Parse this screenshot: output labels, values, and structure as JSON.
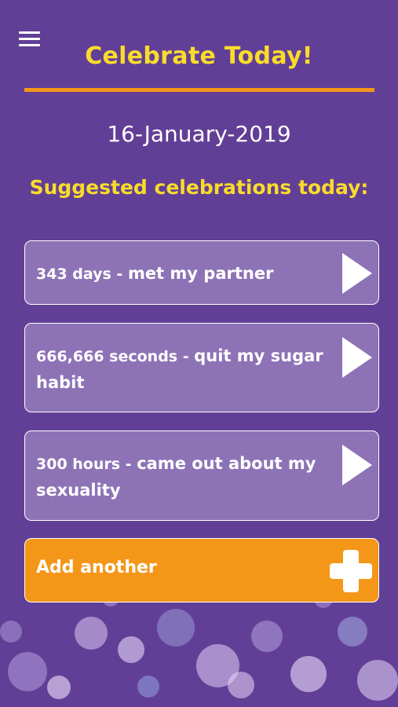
{
  "header": {
    "menu_icon": "hamburger-menu-icon",
    "title": "Celebrate Today!"
  },
  "date": "16-January-2019",
  "subtitle": "Suggested celebrations today:",
  "suggestions": [
    {
      "duration": "343 days - ",
      "description": "met my partner",
      "icon": "play-arrow-icon"
    },
    {
      "duration": "666,666 seconds - ",
      "description": "quit my sugar habit",
      "icon": "play-arrow-icon"
    },
    {
      "duration": "300 hours - ",
      "description": "came out about my sexuality",
      "icon": "play-arrow-icon"
    }
  ],
  "add_button": {
    "label": "Add another",
    "icon": "plus-icon"
  },
  "colors": {
    "background": "#623f96",
    "title_yellow": "#f9dc2b",
    "accent_orange": "#f49719",
    "card_fill": "#8d73b6",
    "text_white": "#ffffff"
  }
}
